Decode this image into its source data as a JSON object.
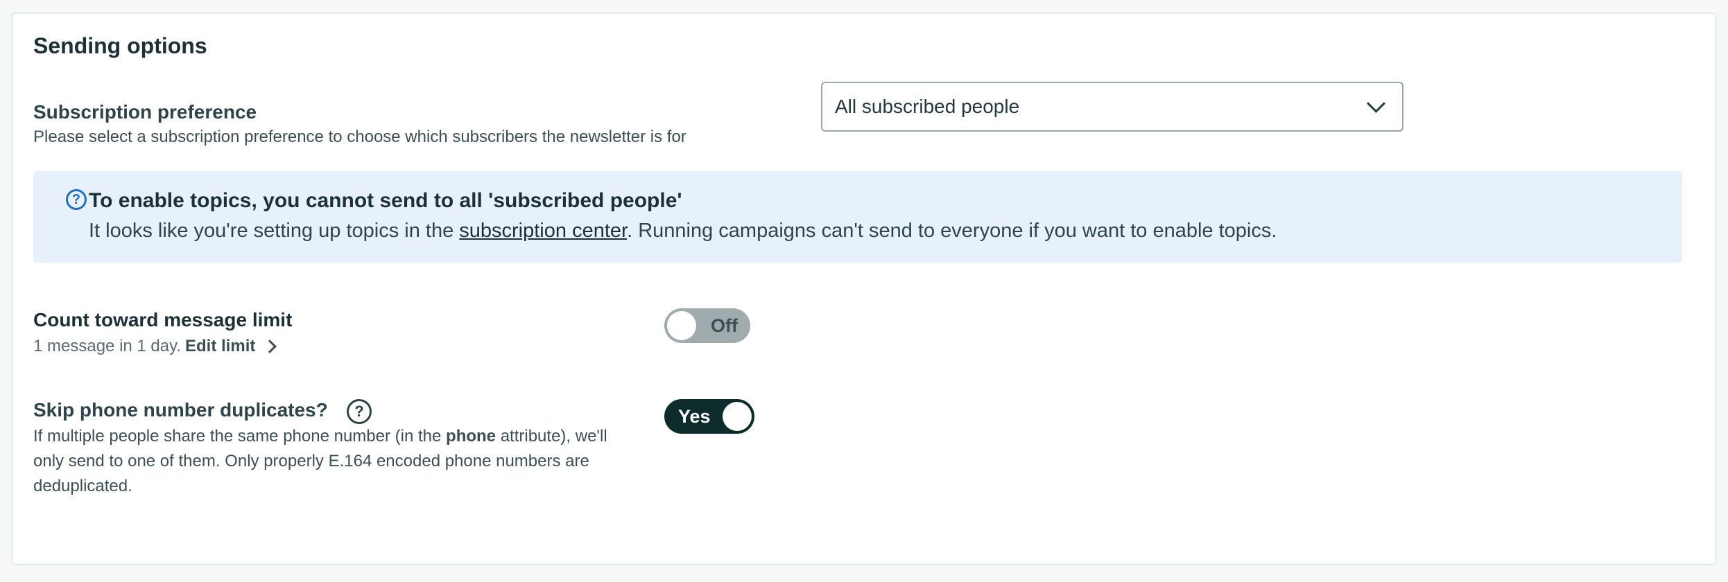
{
  "section": {
    "title": "Sending options"
  },
  "subscription": {
    "label": "Subscription preference",
    "description": "Please select a subscription preference to choose which subscribers the newsletter is for",
    "selected": "All subscribed people"
  },
  "banner": {
    "title": "To enable topics, you cannot send to all 'subscribed people'",
    "text_before": "It looks like you're setting up topics in the ",
    "link": "subscription center",
    "text_after": ". Running campaigns can't send to everyone if you want to enable topics."
  },
  "message_limit": {
    "label": "Count toward message limit",
    "detail": "1 message in 1 day.",
    "edit_label": "Edit limit",
    "toggle_label": "Off"
  },
  "skip_duplicates": {
    "label": "Skip phone number duplicates?",
    "desc_before": "If multiple people share the same phone number (in the ",
    "desc_bold": "phone",
    "desc_line1_after": " attribute), we'll",
    "desc_line2": "only send to one of them. Only properly E.164 encoded phone numbers are",
    "desc_line3": "deduplicated.",
    "toggle_label": "Yes"
  },
  "icons": {
    "help": "?"
  },
  "colors": {
    "banner_bg": "#e6f1fc",
    "info_icon": "#1f6fc1",
    "toggle_on": "#0e2b2b",
    "toggle_off": "#a0abad"
  }
}
